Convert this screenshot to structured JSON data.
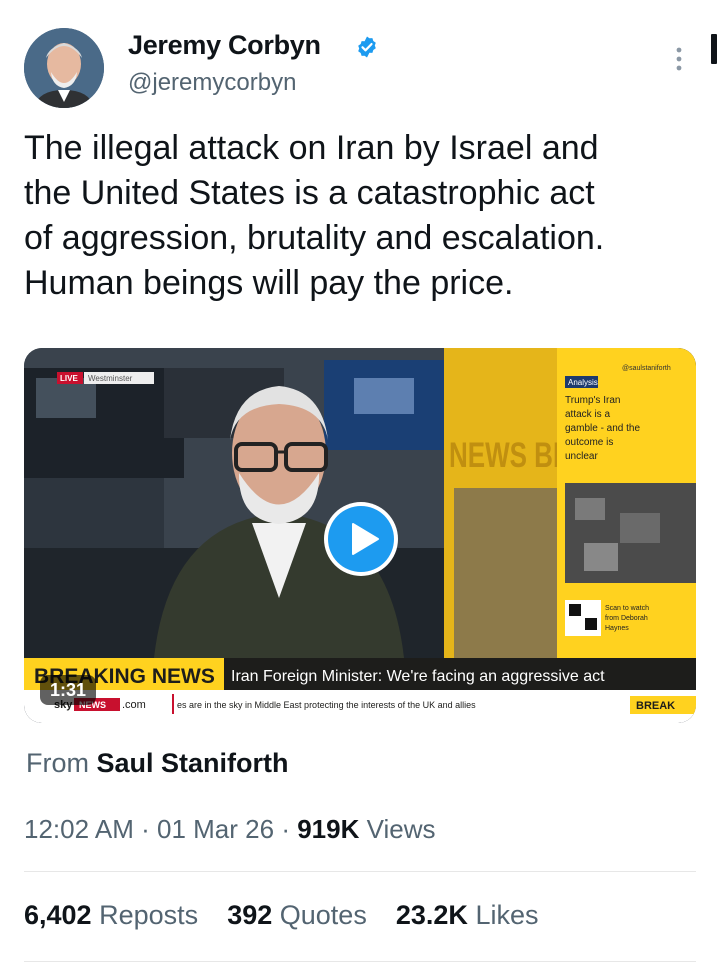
{
  "author": {
    "name": "Jeremy Corbyn",
    "handle": "@jeremycorbyn",
    "verified_icon": "verified-badge-icon",
    "verified_color": "#1d9bf0"
  },
  "tweet": {
    "line1": "The illegal attack on Iran by Israel and",
    "line2": "the United States is a catastrophic act",
    "line3": "of aggression, brutality and escalation.",
    "line4": "Human beings will pay the price."
  },
  "video": {
    "duration": "1:31",
    "live_tag": "LIVE",
    "location_tag": "Westminster",
    "breaking_label": "BREAKING NEWS",
    "headline": "Iran Foreign Minister: We're facing an aggressive act",
    "ticker": "es are in the sky in Middle East protecting the interests of the UK and allies",
    "brand_left": "sky",
    "brand_box": "NEWS",
    "brand_right": ".com",
    "ticker_right": "BREAK",
    "bg_news_text": "NEWS BRE",
    "panel_tag": "Analysis",
    "panel_handle": "@saulstaniforth",
    "panel_l1": "Trump's Iran",
    "panel_l2": "attack is a",
    "panel_l3": "gamble - and the",
    "panel_l4": "outcome is",
    "panel_l5": "unclear",
    "scan_l1": "Scan to watch",
    "scan_l2": "from Deborah",
    "scan_l3": "Haynes",
    "play_icon": "play-icon",
    "accent": "#ffd21f"
  },
  "source": {
    "prefix": "From",
    "name": "Saul Staniforth"
  },
  "meta": {
    "time": "12:02 AM",
    "date": "01 Mar 26",
    "views_count": "919K",
    "views_label": "Views"
  },
  "stats": {
    "reposts_count": "6,402",
    "reposts_label": "Reposts",
    "quotes_count": "392",
    "quotes_label": "Quotes",
    "likes_count": "23.2K",
    "likes_label": "Likes"
  }
}
